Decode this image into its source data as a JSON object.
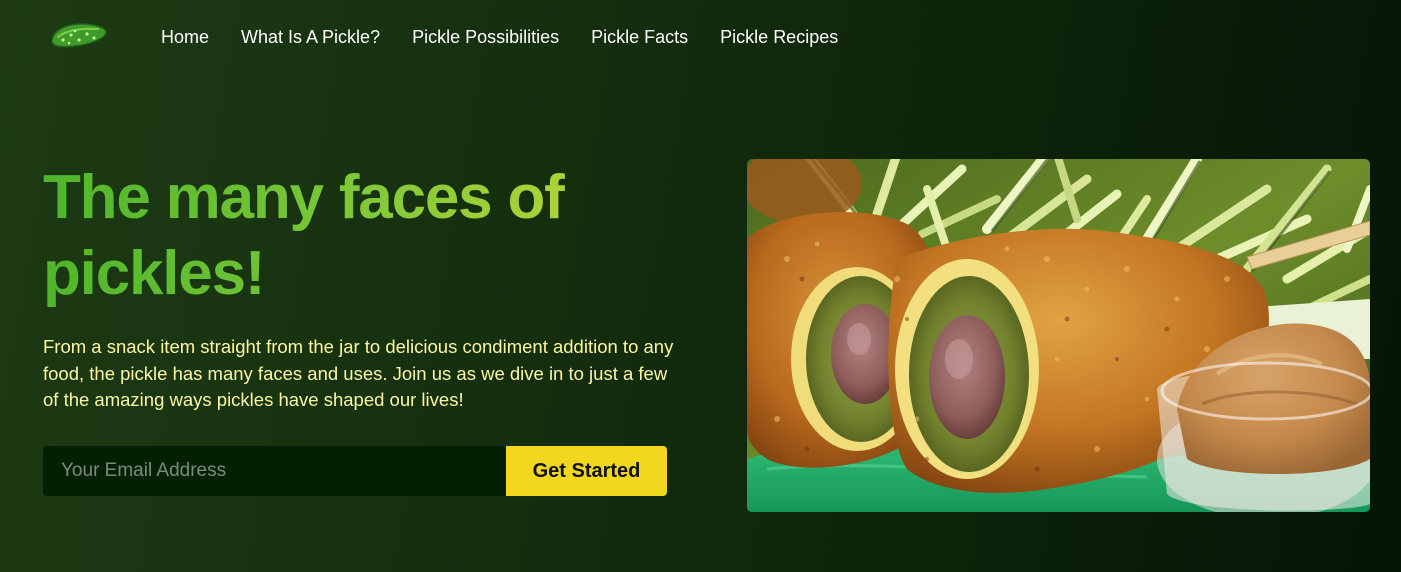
{
  "logo": {
    "icon": "pickle-icon",
    "color": "#3f9a2c"
  },
  "nav": {
    "items": [
      {
        "label": "Home"
      },
      {
        "label": "What Is A Pickle?"
      },
      {
        "label": "Pickle Possibilities"
      },
      {
        "label": "Pickle Facts"
      },
      {
        "label": "Pickle Recipes"
      }
    ]
  },
  "hero": {
    "title": "The many faces of pickles!",
    "description": "From a snack item straight from the jar to delicious condiment addition to any food, the pickle has many faces and uses. Join us as we dive in to just a few of the amazing ways pickles have shaped our lives!",
    "email_placeholder": "Your Email Address",
    "cta_label": "Get Started"
  },
  "colors": {
    "background": "#15300f",
    "title_gradient_start": "#4fb52b",
    "title_gradient_end": "#c8d83a",
    "description_text": "#fdf6a0",
    "cta_background": "#f1d81e",
    "input_background": "#042004"
  }
}
